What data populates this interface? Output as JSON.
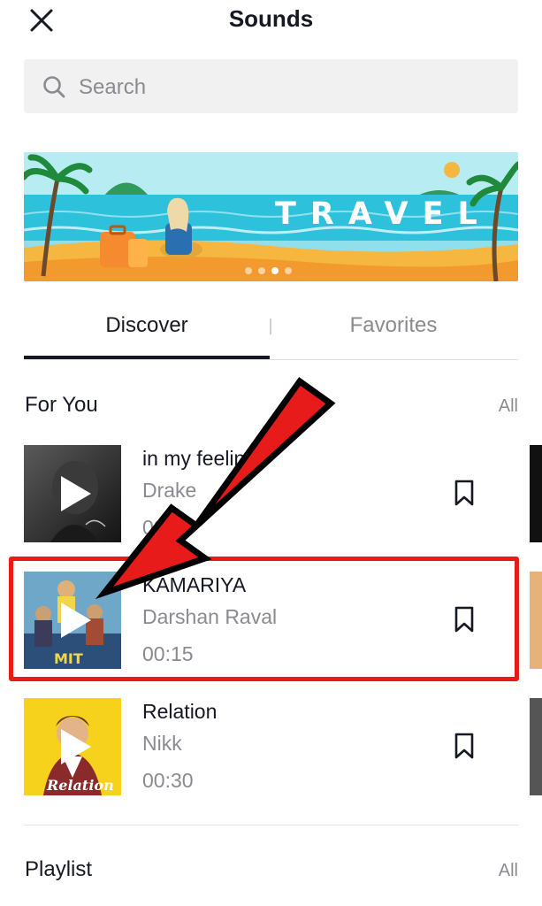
{
  "header": {
    "title": "Sounds",
    "close_icon": "close-icon"
  },
  "search": {
    "placeholder": "Search",
    "value": "",
    "icon": "search-icon"
  },
  "banner": {
    "text": "TRAVEL",
    "slides": 4,
    "active_slide": 3,
    "colors": {
      "sky": "#2ec1dc",
      "sand": "#f6b740",
      "sea": "#1c8fcf"
    }
  },
  "tabs": [
    {
      "label": "Discover",
      "active": true
    },
    {
      "label": "Favorites",
      "active": false
    }
  ],
  "for_you": {
    "title": "For You",
    "all_label": "All",
    "songs": [
      {
        "title": "in my feelings",
        "artist": "Drake",
        "duration": "00:30",
        "icon": "bookmark-icon"
      },
      {
        "title": "KAMARIYA",
        "artist": "Darshan Raval",
        "duration": "00:15",
        "icon": "bookmark-icon",
        "highlighted": true
      },
      {
        "title": "Relation",
        "artist": "Nikk",
        "duration": "00:30",
        "icon": "bookmark-icon"
      }
    ]
  },
  "playlist": {
    "title": "Playlist",
    "all_label": "All"
  },
  "annotation": {
    "color": "#e81b1b",
    "type": "arrow-and-box"
  }
}
